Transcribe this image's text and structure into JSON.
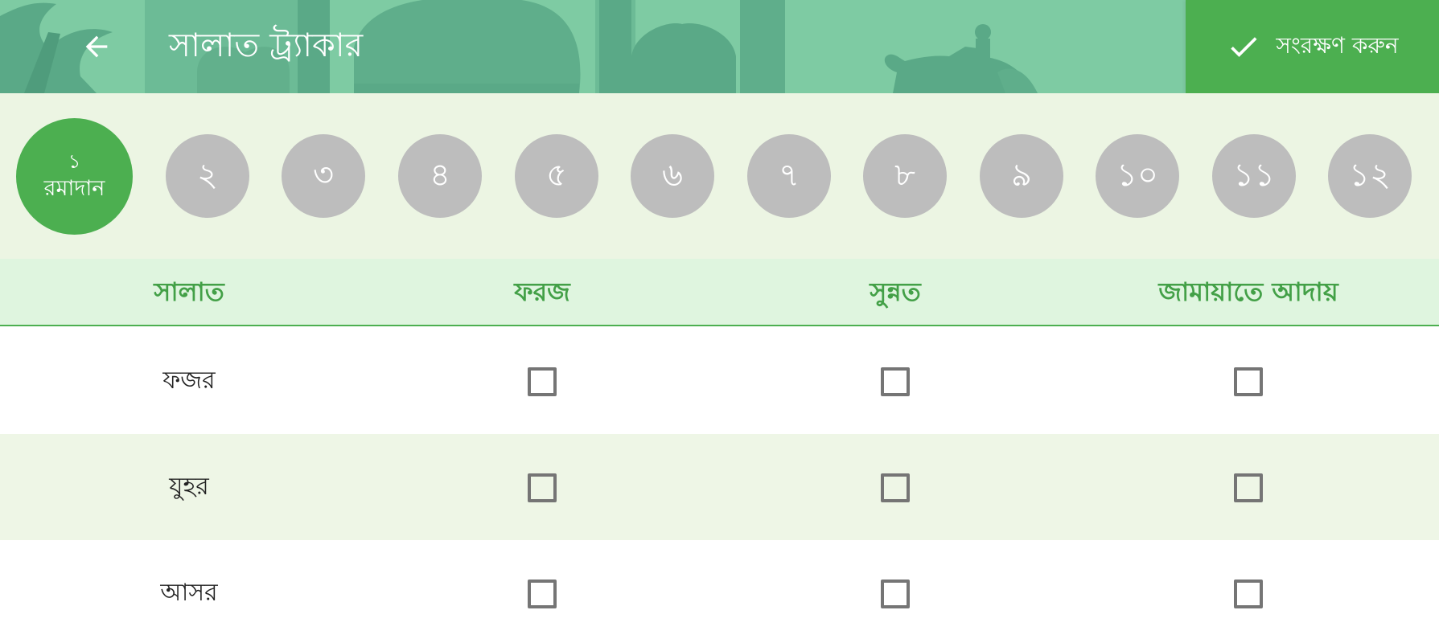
{
  "appbar": {
    "title": "সালাত ট্র্যাকার",
    "save_label": "সংরক্ষণ করুন"
  },
  "days": {
    "active": {
      "number": "১",
      "month": "রমাদান"
    },
    "others": [
      "২",
      "৩",
      "৪",
      "৫",
      "৬",
      "৭",
      "৮",
      "৯",
      "১০",
      "১১",
      "১২"
    ]
  },
  "table": {
    "headers": [
      "সালাত",
      "ফরজ",
      "সুন্নত",
      "জামায়াতে আদায়"
    ],
    "rows": [
      {
        "name": "ফজর",
        "checked": [
          false,
          false,
          false
        ]
      },
      {
        "name": "যুহর",
        "checked": [
          false,
          false,
          false
        ]
      },
      {
        "name": "আসর",
        "checked": [
          false,
          false,
          false
        ]
      }
    ]
  },
  "colors": {
    "primary": "#4caf50",
    "appbar_bg": "#7ecba3",
    "day_inactive": "#bdbdbd",
    "header_text": "#43a047",
    "strip_bg": "#ecf5e3"
  },
  "icons": [
    "back-arrow-icon",
    "check-icon",
    "mosque-silhouette"
  ]
}
